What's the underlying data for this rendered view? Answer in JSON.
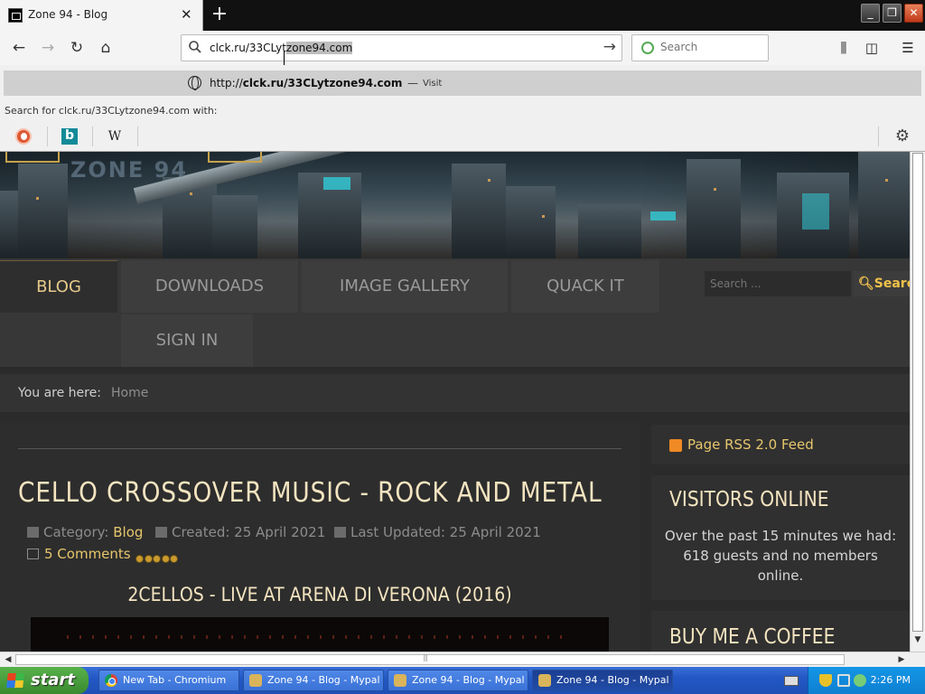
{
  "browser": {
    "tab_title": "Zone 94 - Blog",
    "url_plain": "clck.ru/33CLyt",
    "url_selected": "zone94.com",
    "search_placeholder": "Search",
    "visit_url_prefix": "http://",
    "visit_url_bold": "clck.ru/33CLytzone94.com",
    "visit_dash": "—",
    "visit_label": "Visit",
    "search_for_text": "Search for clck.ru/33CLytzone94.com with:",
    "engines": [
      "duckduckgo-icon",
      "bing-icon",
      "wikipedia-icon"
    ],
    "engine_wiki_glyph": "W",
    "bookmarks_icon": "library-icon",
    "sidebar_icon": "sidebar-icon",
    "menu_icon": "hamburger-menu-icon"
  },
  "page": {
    "nav": {
      "items": [
        "BLOG",
        "DOWNLOADS",
        "IMAGE GALLERY",
        "QUACK IT",
        "SIGN IN"
      ],
      "active": "BLOG",
      "search_placeholder": "Search ...",
      "search_button": "Search"
    },
    "breadcrumb": {
      "label": "You are here:",
      "home": "Home"
    },
    "article": {
      "title": "CELLO CROSSOVER MUSIC - ROCK AND METAL",
      "category_label": "Category:",
      "category": "Blog",
      "created": "Created: 25 April 2021",
      "updated": "Last Updated: 25 April 2021",
      "comments": "5 Comments",
      "rating_stars": 5,
      "video_title": "2CELLOS - LIVE AT ARENA DI VERONA (2016)"
    },
    "sidebar": {
      "rss": "Page RSS 2.0 Feed",
      "visitors_title": "VISITORS ONLINE",
      "visitors_text": "Over the past 15 minutes we had: 618 guests and no members online.",
      "coffee_title": "BUY ME A COFFEE"
    },
    "banner_logo_text": "ZONE 94"
  },
  "taskbar": {
    "start_label": "start",
    "tasks": [
      {
        "label": "New Tab - Chromium",
        "icon": "chromium-icon",
        "active": false
      },
      {
        "label": "Zone 94 - Blog - Mypal",
        "icon": "mypal-icon",
        "active": false
      },
      {
        "label": "Zone 94 - Blog - Mypal",
        "icon": "mypal-icon",
        "active": false
      },
      {
        "label": "Zone 94 - Blog - Mypal",
        "icon": "mypal-icon",
        "active": true
      }
    ],
    "clock": "2:26 PM"
  },
  "colors": {
    "accent_gold": "#e7c66c",
    "heading_cream": "#f4e4c0",
    "page_bg": "#2b2b2b",
    "xp_blue": "#2358c5",
    "xp_start_green": "#3a8a2e"
  }
}
